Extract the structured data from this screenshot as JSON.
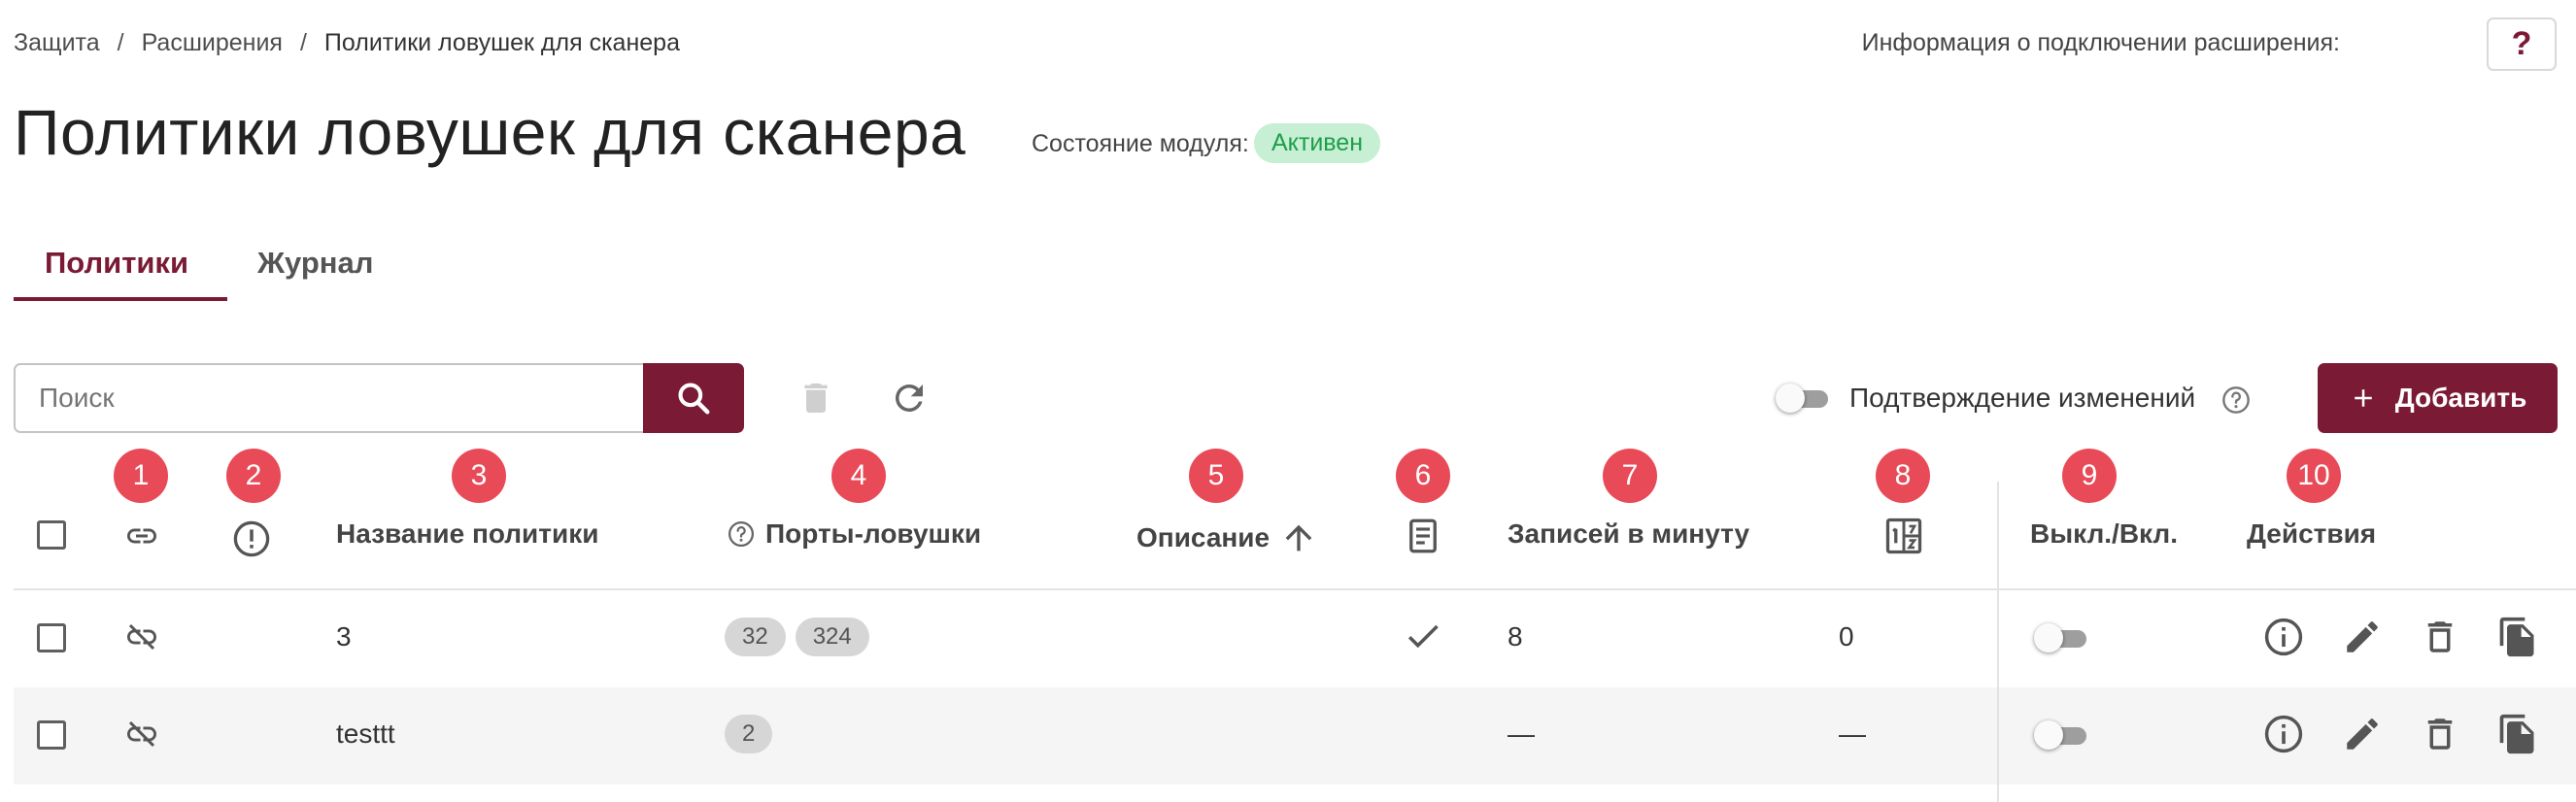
{
  "breadcrumb": {
    "items": [
      "Защита",
      "Расширения",
      "Политики ловушек для сканера"
    ],
    "separator": "/"
  },
  "help": {
    "label": "Информация о подключении расширения:",
    "button": "?"
  },
  "page": {
    "title": "Политики ловушек для сканера",
    "module_state_label": "Состояние модуля:",
    "module_state": "Активен"
  },
  "tabs": [
    {
      "label": "Политики",
      "active": true
    },
    {
      "label": "Журнал",
      "active": false
    }
  ],
  "toolbar": {
    "search_placeholder": "Поиск",
    "search_value": "",
    "confirm_label": "Подтверждение изменений",
    "confirm_enabled": false,
    "add_label": "Добавить"
  },
  "markers": [
    "1",
    "2",
    "3",
    "4",
    "5",
    "6",
    "7",
    "8",
    "9",
    "10"
  ],
  "table": {
    "columns": {
      "link": "link-icon",
      "alert": "alert-circle-icon",
      "name": "Название политики",
      "ports": "Порты-ловушки",
      "description": "Описание",
      "log": "document-icon",
      "per_minute": "Записей в минуту",
      "counter": "counter-icon",
      "toggle": "Выкл./Вкл.",
      "actions": "Действия"
    },
    "sort": {
      "column": "description",
      "direction": "asc"
    },
    "rows": [
      {
        "name": "3",
        "ports": [
          "32",
          "324"
        ],
        "description": "",
        "log": true,
        "per_minute": "8",
        "counter": "0",
        "enabled": false
      },
      {
        "name": "testtt",
        "ports": [
          "2"
        ],
        "description": "",
        "log": false,
        "per_minute": "—",
        "counter": "—",
        "enabled": false
      }
    ]
  },
  "colors": {
    "accent": "#7a1a35",
    "marker": "#e84a57",
    "status_bg": "#c6efd3",
    "status_text": "#1e9e4a"
  }
}
